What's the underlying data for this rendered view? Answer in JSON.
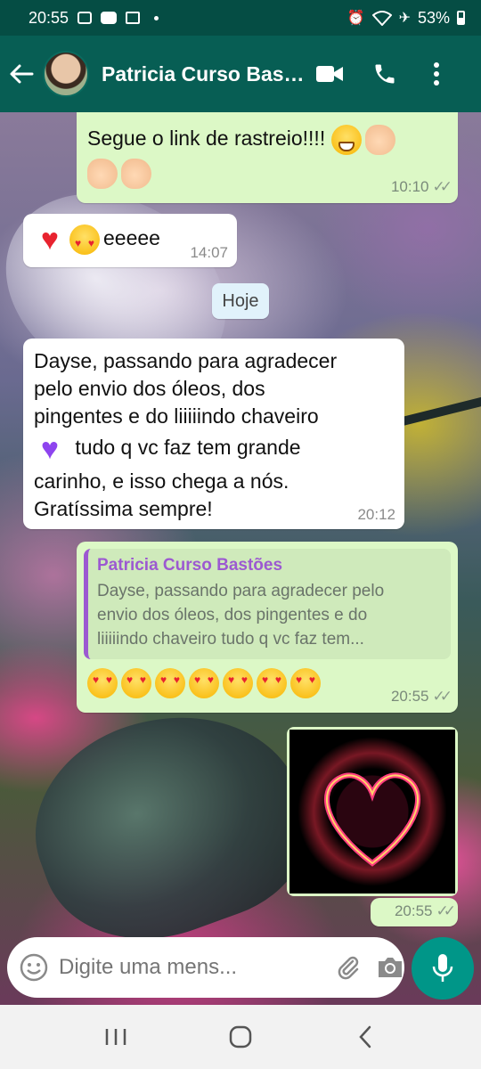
{
  "status_bar": {
    "time": "20:55",
    "battery": "53%"
  },
  "header": {
    "back_icon": "arrow-left-icon",
    "contact_name": "Patricia Curso Bastões"
  },
  "messages": [
    {
      "type": "outgoing",
      "text": "Segue o link de rastreio!!!!",
      "time": "10:10",
      "status": "read"
    },
    {
      "type": "incoming",
      "text": "eeeee",
      "time": "14:07"
    },
    {
      "type": "date_chip",
      "text": "Hoje"
    },
    {
      "type": "incoming",
      "lines": [
        "Dayse, passando para agradecer",
        "pelo envio dos óleos, dos",
        "pingentes e do liiiiindo chaveiro",
        " tudo q vc faz tem grande",
        "carinho, e isso chega a nós.",
        "Gratíssima sempre!"
      ],
      "time": "20:12"
    },
    {
      "type": "outgoing_reply",
      "quote_author": "Patricia Curso Bastões",
      "quote_lines": [
        "Dayse, passando para agradecer pelo",
        "envio dos óleos, dos pingentes e do",
        "liiiiindo chaveiro  tudo q vc faz tem..."
      ],
      "emoji_count": 7,
      "time": "20:55",
      "status": "read"
    },
    {
      "type": "outgoing_image",
      "time": "20:55",
      "status": "read"
    }
  ],
  "input": {
    "placeholder": "Digite uma mens..."
  },
  "colors": {
    "header": "#075e54",
    "outgoing_bubble": "#dcf8c6",
    "incoming_bubble": "#ffffff",
    "accent": "#009688",
    "quote_author": "#9c59d1"
  }
}
